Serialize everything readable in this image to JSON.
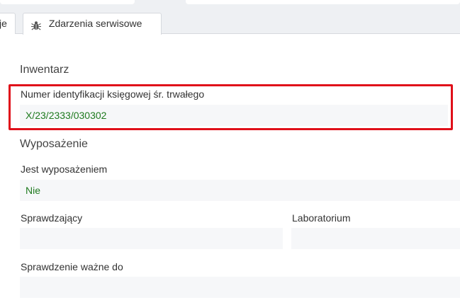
{
  "tabs": [
    {
      "label": "je",
      "active": false
    },
    {
      "label": "Zdarzenia serwisowe",
      "active": true,
      "icon": "bug-icon"
    }
  ],
  "sections": {
    "inventory": {
      "title": "Inwentarz",
      "fields": {
        "asset_number": {
          "label": "Numer identyfikacji księgowej śr. trwałego",
          "value": "X/23/2333/030302"
        }
      }
    },
    "equipment": {
      "title": "Wyposażenie",
      "fields": {
        "is_equipment": {
          "label": "Jest wyposażeniem",
          "value": "Nie"
        },
        "checker": {
          "label": "Sprawdzający",
          "value": ""
        },
        "laboratory": {
          "label": "Laboratorium",
          "value": ""
        },
        "valid_until": {
          "label": "Sprawdzenie ważne do",
          "value": ""
        }
      }
    }
  },
  "colors": {
    "value_text": "#1e7a1e",
    "highlight_border": "#e0101a",
    "field_background": "#f6f7f9"
  }
}
